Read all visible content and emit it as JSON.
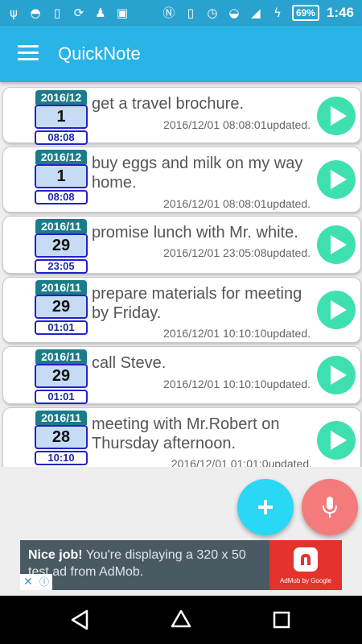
{
  "status_bar": {
    "left_icons": [
      "usb-icon",
      "wifi-off-icon",
      "phone-icon",
      "sync-icon",
      "android-icon",
      "nfc-icon"
    ],
    "right_icons": [
      "nfc-n-icon",
      "vibrate-icon",
      "alarm-icon",
      "wifi-icon",
      "signal-icon",
      "charging-icon"
    ],
    "battery": "69%",
    "time": "1:46"
  },
  "app_bar": {
    "title": "QuickNote",
    "menu_icon": "menu-icon",
    "color": "#2ab3e6"
  },
  "notes": [
    {
      "ym": "2016/12",
      "day": "1",
      "time": "08:08",
      "text": "get a travel brochure.",
      "updated": "2016/12/01 08:08:01updated."
    },
    {
      "ym": "2016/12",
      "day": "1",
      "time": "08:08",
      "text": "buy eggs and milk on my way home.",
      "updated": "2016/12/01 08:08:01updated."
    },
    {
      "ym": "2016/11",
      "day": "29",
      "time": "23:05",
      "text": "promise lunch with Mr. white.",
      "updated": "2016/12/01 23:05:08updated."
    },
    {
      "ym": "2016/11",
      "day": "29",
      "time": "01:01",
      "text": "prepare materials for meeting by Friday.",
      "updated": "2016/12/01 10:10:10updated."
    },
    {
      "ym": "2016/11",
      "day": "29",
      "time": "01:01",
      "text": "call Steve.",
      "updated": "2016/12/01 10:10:10updated."
    },
    {
      "ym": "2016/11",
      "day": "28",
      "time": "10:10",
      "text": "meeting with Mr.Robert on Thursday afternoon.",
      "updated": "2016/12/01 01:01:0updated."
    }
  ],
  "fabs": {
    "add_icon": "plus-icon",
    "add_color": "#29d8f5",
    "mic_icon": "microphone-icon",
    "mic_color": "#f37b7b"
  },
  "ad": {
    "headline": "Nice job!",
    "body": " You're displaying a 320 x 50 test ad from AdMob.",
    "brand": "AdMob by Google"
  },
  "nav_bar": {
    "back": "back-icon",
    "home": "home-icon",
    "recents": "recents-icon"
  }
}
